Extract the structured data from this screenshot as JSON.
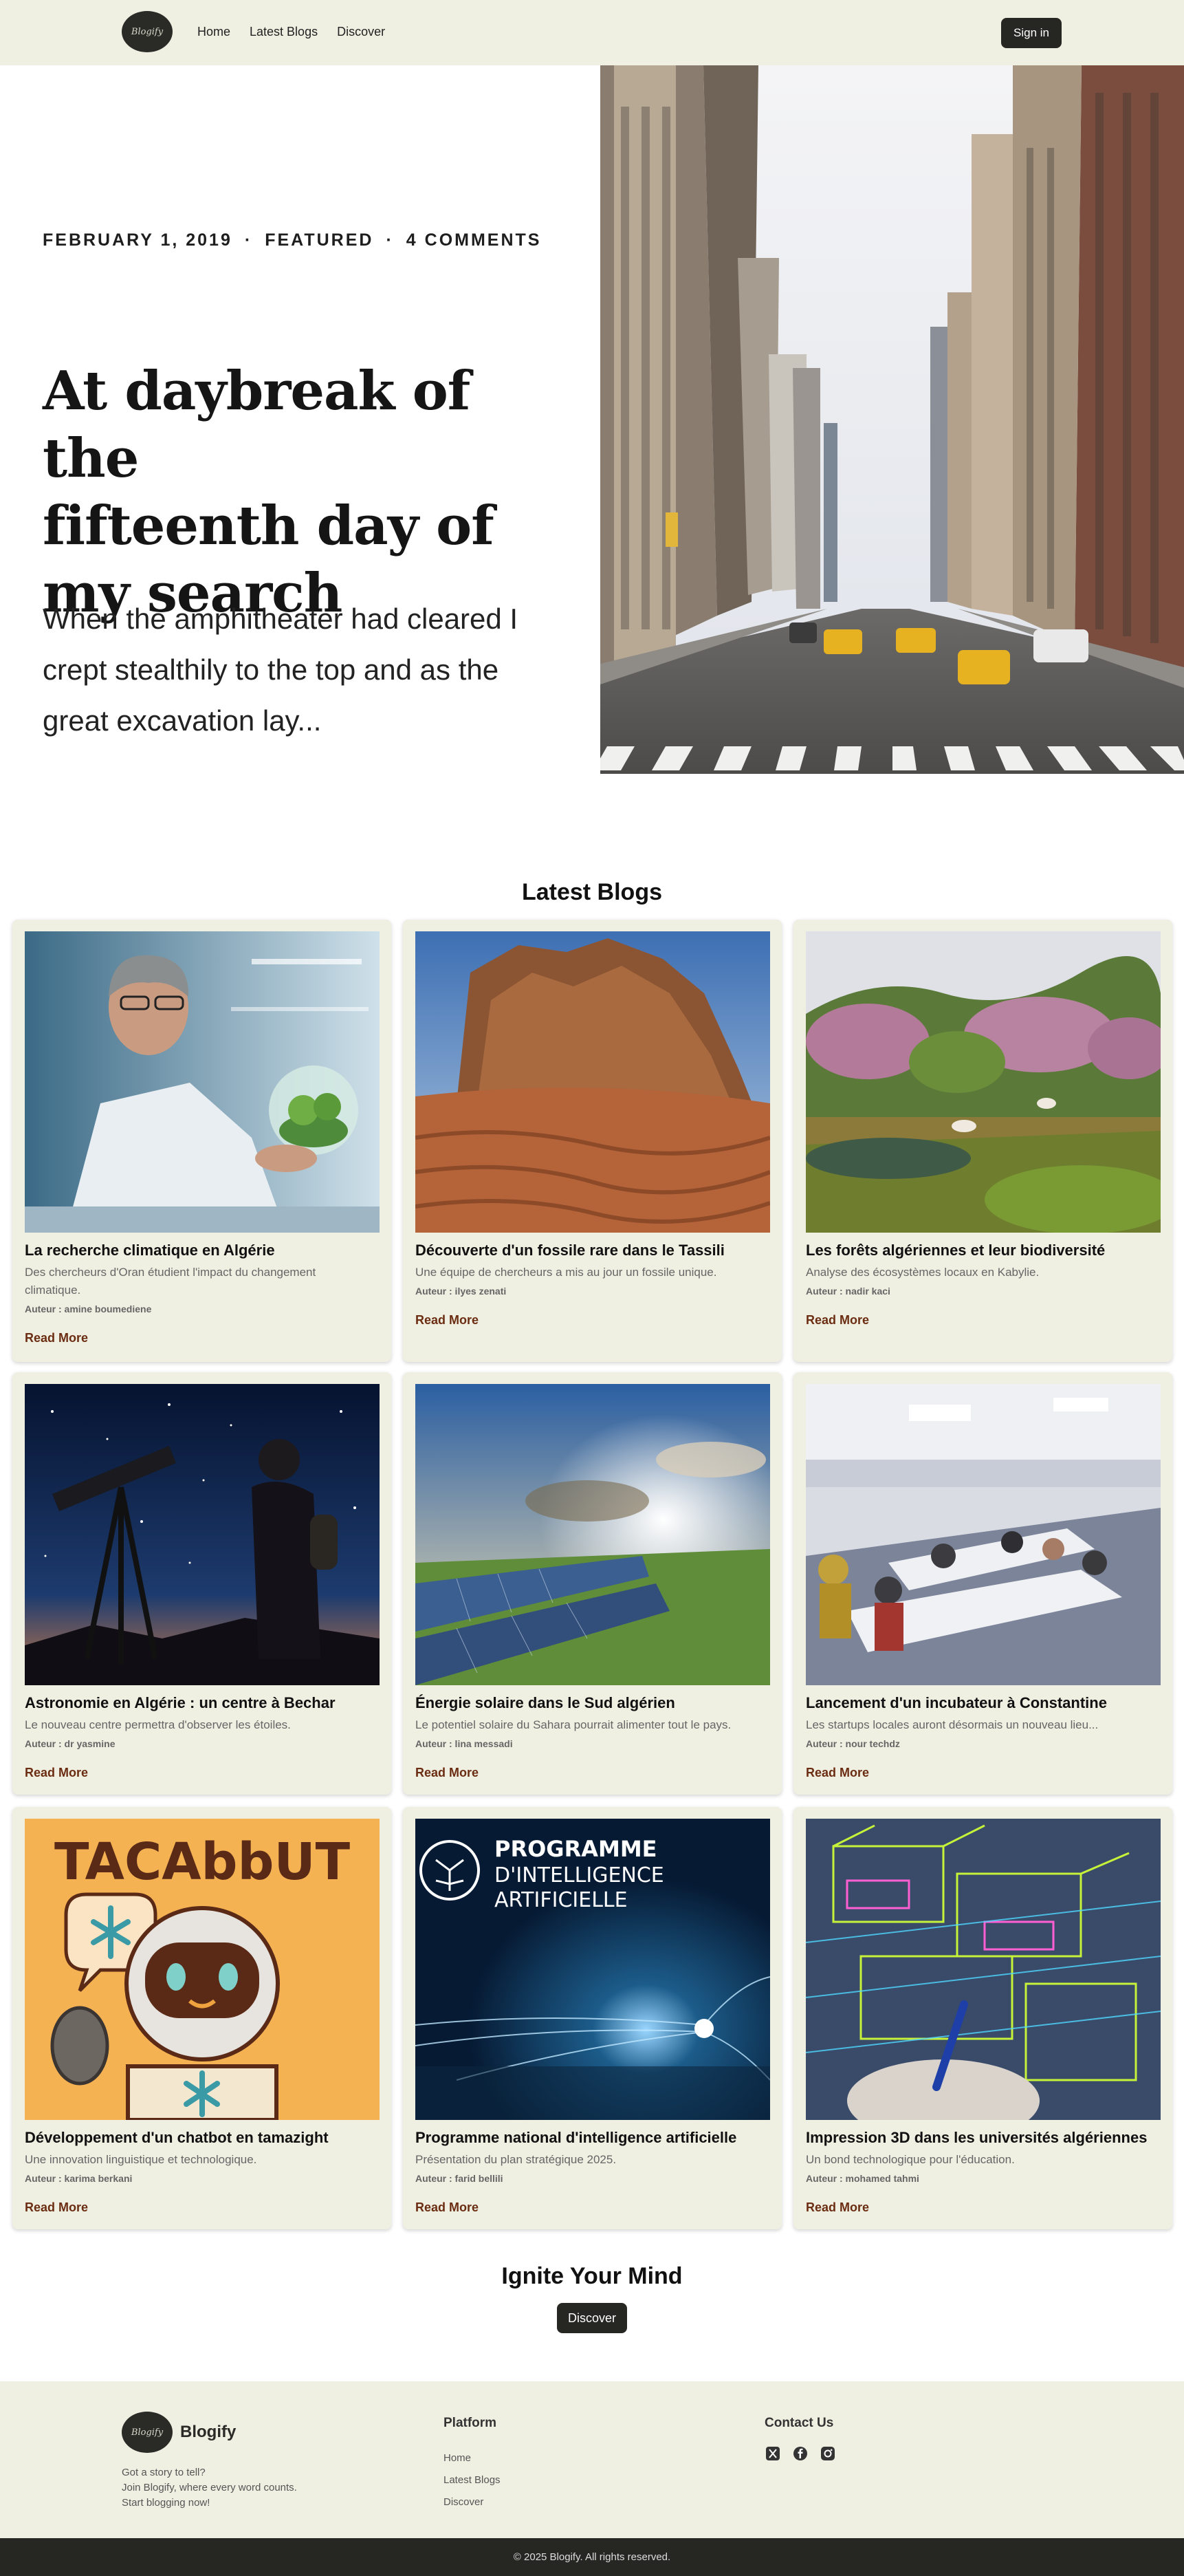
{
  "nav": {
    "logo_text": "Blogify",
    "links": [
      "Home",
      "Latest Blogs",
      "Discover"
    ],
    "signin": "Sign in"
  },
  "hero": {
    "date": "FEBRUARY 1, 2019",
    "sep": "·",
    "category": "FEATURED",
    "comments": "4 COMMENTS",
    "title_lines": [
      "At daybreak of the",
      "fifteenth day of",
      "my search"
    ],
    "excerpt_lines": [
      "When the amphitheater had cleared I",
      "crept stealthily to the top and as the",
      "great excavation lay..."
    ]
  },
  "latest": {
    "title": "Latest Blogs",
    "read_more": "Read More",
    "cards": [
      {
        "title": "La recherche climatique en Algérie",
        "desc": "Des chercheurs d'Oran étudient l'impact du changement climatique.",
        "author": "Auteur : amine boumediene"
      },
      {
        "title": "Découverte d'un fossile rare dans le Tassili",
        "desc": "Une équipe de chercheurs a mis au jour un fossile unique.",
        "author": "Auteur : ilyes zenati"
      },
      {
        "title": "Les forêts algériennes et leur biodiversité",
        "desc": "Analyse des écosystèmes locaux en Kabylie.",
        "author": "Auteur : nadir kaci"
      },
      {
        "title": "Astronomie en Algérie : un centre à Bechar",
        "desc": "Le nouveau centre permettra d'observer les étoiles.",
        "author": "Auteur : dr yasmine"
      },
      {
        "title": "Énergie solaire dans le Sud algérien",
        "desc": "Le potentiel solaire du Sahara pourrait alimenter tout le pays.",
        "author": "Auteur : lina messadi"
      },
      {
        "title": "Lancement d'un incubateur à Constantine",
        "desc": "Les startups locales auront désormais un nouveau lieu...",
        "author": "Auteur : nour techdz"
      },
      {
        "title": "Développement d'un chatbot en tamazight",
        "desc": "Une innovation linguistique et technologique.",
        "author": "Auteur : karima berkani"
      },
      {
        "title": "Programme national d'intelligence artificielle",
        "desc": "Présentation du plan stratégique 2025.",
        "author": "Auteur : farid bellili"
      },
      {
        "title": "Impression 3D dans les universités algériennes",
        "desc": "Un bond technologique pour l'éducation.",
        "author": "Auteur : mohamed tahmi"
      }
    ],
    "art": {
      "tamazight_text": "TACAbbUT",
      "ai_title": [
        "PROGRAMME",
        "D'INTELLIGENCE",
        "ARTIFICIELLE"
      ]
    }
  },
  "cta": {
    "title": "Ignite Your Mind",
    "button": "Discover"
  },
  "footer": {
    "brand": "Blogify",
    "tagline_lines": [
      "Got a story to tell?",
      "Join Blogify, where every word counts.",
      "Start blogging now!"
    ],
    "platform_head": "Platform",
    "platform_links": [
      "Home",
      "Latest Blogs",
      "Discover"
    ],
    "contact_head": "Contact Us",
    "social_icons": [
      "x-icon",
      "facebook-icon",
      "instagram-icon"
    ],
    "copyright": "© 2025 Blogify. All rights reserved."
  }
}
